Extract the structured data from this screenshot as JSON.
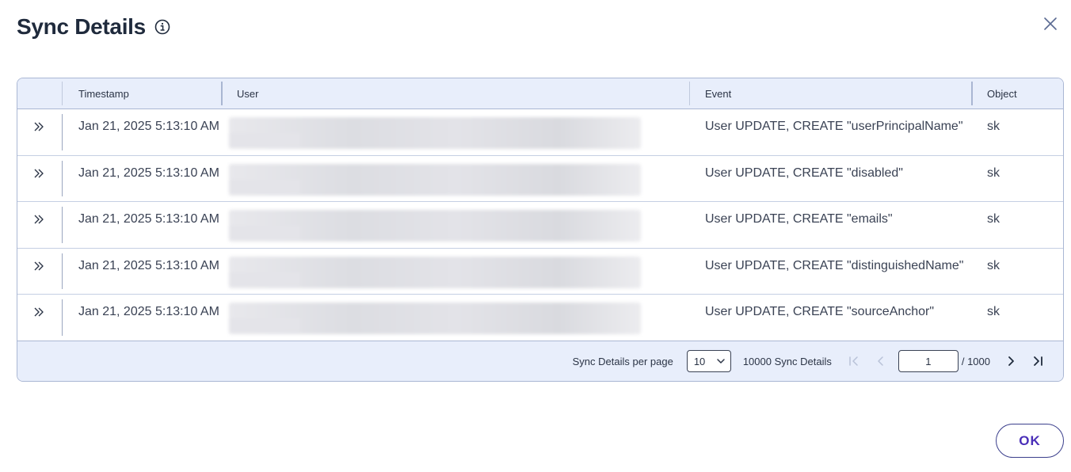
{
  "dialog": {
    "title": "Sync Details",
    "ok_label": "OK"
  },
  "icons": {
    "info": "info-icon",
    "close": "close-icon",
    "expand": "double-chevron-right-icon",
    "dropdown": "chevron-down-icon",
    "first": "first-page-icon",
    "prev": "chevron-left-icon",
    "next": "chevron-right-icon",
    "last": "last-page-icon"
  },
  "table": {
    "columns": [
      "",
      "Timestamp",
      "User",
      "Event",
      "Object"
    ],
    "rows": [
      {
        "timestamp": "Jan 21, 2025 5:13:10 AM",
        "user": "",
        "event": "User UPDATE, CREATE \"userPrincipalName\"",
        "object": "sk"
      },
      {
        "timestamp": "Jan 21, 2025 5:13:10 AM",
        "user": "",
        "event": "User UPDATE, CREATE \"disabled\"",
        "object": "sk"
      },
      {
        "timestamp": "Jan 21, 2025 5:13:10 AM",
        "user": "",
        "event": "User UPDATE, CREATE \"emails\"",
        "object": "sk"
      },
      {
        "timestamp": "Jan 21, 2025 5:13:10 AM",
        "user": "",
        "event": "User UPDATE, CREATE \"distinguishedName\"",
        "object": "sk"
      },
      {
        "timestamp": "Jan 21, 2025 5:13:10 AM",
        "user": "",
        "event": "User UPDATE, CREATE \"sourceAnchor\"",
        "object": "sk"
      }
    ]
  },
  "pagination": {
    "per_page_label": "Sync Details per page",
    "page_size": "10",
    "total_label": "10000 Sync Details",
    "current_page": "1",
    "page_of": "/ 1000"
  },
  "colors": {
    "header_bg": "#e8eefb",
    "border": "#aab7d4",
    "accent": "#4a2fb8"
  }
}
